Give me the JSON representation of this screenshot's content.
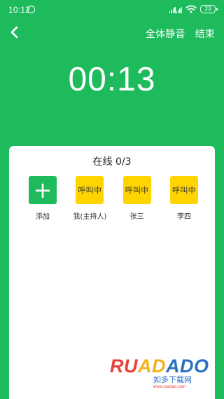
{
  "status_bar": {
    "time": "10:12",
    "battery": "23",
    "icons": {
      "notification": "sync-notification-icon",
      "signal": "signal-icon",
      "wifi": "wifi-icon",
      "battery": "battery-icon"
    }
  },
  "topbar": {
    "back_icon": "chevron-left-icon",
    "mute_all": "全体静音",
    "end": "结束"
  },
  "timer": "00:13",
  "panel": {
    "online_count": "在线 0/3"
  },
  "participants": [
    {
      "label": "添加",
      "avatar_text": "+",
      "type": "add"
    },
    {
      "label": "我(主持人)",
      "avatar_text": "呼叫中",
      "type": "calling"
    },
    {
      "label": "张三",
      "avatar_text": "呼叫中",
      "type": "calling"
    },
    {
      "label": "李四",
      "avatar_text": "呼叫中",
      "type": "calling"
    }
  ],
  "watermark": {
    "brand": "RUADADO",
    "sub": "如多下载网",
    "url": "www.ruadao.com"
  },
  "colors": {
    "accent_green": "#1dbb5b",
    "calling_yellow": "#ffd400",
    "panel_bg": "#ffffff"
  }
}
